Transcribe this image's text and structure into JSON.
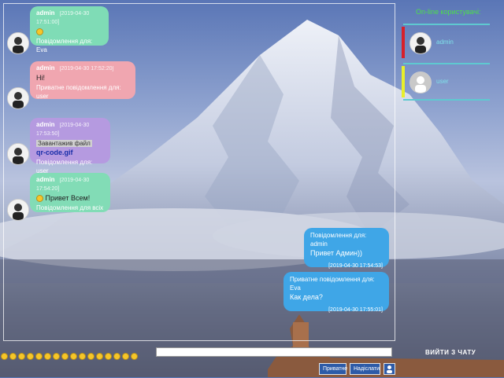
{
  "messages": [
    {
      "author": "admin",
      "time": "[2019-04-30 17:51:00]",
      "recipient": "Повідомлення для: Eva",
      "style": "green"
    },
    {
      "author": "admin",
      "time": "[2019-04-30 17:52:20]",
      "text": "Hi!",
      "recipient": "Приватне повідомлення для: user",
      "style": "pink"
    },
    {
      "author": "admin",
      "time": "[2019-04-30 17:53:50]",
      "file_note": "Завантажив файл",
      "file_link": "qr-code.gif",
      "recipient": "Повідомлення для: user",
      "style": "purple"
    },
    {
      "author": "admin",
      "time": "[2019-04-30 17:54:20]",
      "text": "Привет Всем!",
      "recipient": "Повідомлення для всіх",
      "style": "green2"
    }
  ],
  "outgoing": [
    {
      "recipient": "Повідомлення для: admin",
      "text": "Привет Админ))",
      "time": "[2019-04-30 17:54:53]"
    },
    {
      "recipient": "Приватне повідомлення для: Eva",
      "text": "Как дела?",
      "time": "[2019-04-30 17:55:01]"
    }
  ],
  "sidebar": {
    "title": "On-line користувачі:",
    "users": [
      {
        "name": "admin",
        "bar_color": "#d8202a"
      },
      {
        "name": "user",
        "bar_color": "#e8ef2a"
      }
    ]
  },
  "bottom": {
    "exit_label": "ВИЙТИ З ЧАТУ",
    "private_button": "Приватне",
    "send_button": "Надіслати",
    "input_value": ""
  },
  "colors": {
    "accent": "#3fa6e7",
    "online_title": "#4ce04a"
  }
}
